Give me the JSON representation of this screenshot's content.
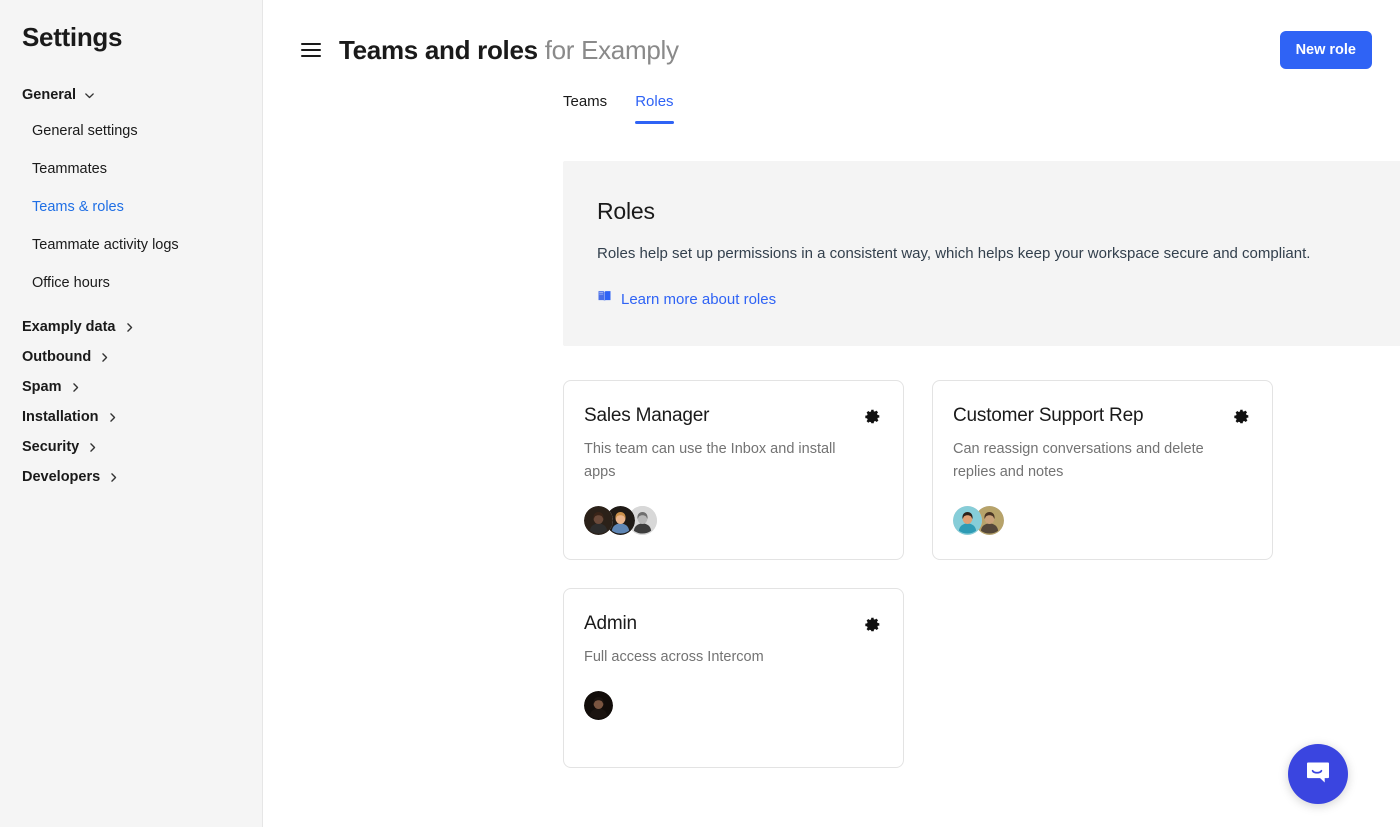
{
  "sidebar": {
    "title": "Settings",
    "groups": [
      {
        "label": "General",
        "icon": "chevron-down-icon",
        "expanded": true,
        "items": [
          {
            "label": "General settings",
            "active": false
          },
          {
            "label": "Teammates",
            "active": false
          },
          {
            "label": "Teams & roles",
            "active": true
          },
          {
            "label": "Teammate activity logs",
            "active": false
          },
          {
            "label": "Office hours",
            "active": false
          }
        ]
      },
      {
        "label": "Examply data",
        "icon": "chevron-right-icon",
        "expanded": false,
        "items": []
      },
      {
        "label": "Outbound",
        "icon": "chevron-right-icon",
        "expanded": false,
        "items": []
      },
      {
        "label": "Spam",
        "icon": "chevron-right-icon",
        "expanded": false,
        "items": []
      },
      {
        "label": "Installation",
        "icon": "chevron-right-icon",
        "expanded": false,
        "items": []
      },
      {
        "label": "Security",
        "icon": "chevron-right-icon",
        "expanded": false,
        "items": []
      },
      {
        "label": "Developers",
        "icon": "chevron-right-icon",
        "expanded": false,
        "items": []
      }
    ]
  },
  "header": {
    "menu_icon": "hamburger-icon",
    "title": "Teams and roles",
    "title_suffix": "for Examply",
    "new_role_label": "New role"
  },
  "tabs": [
    {
      "label": "Teams",
      "active": false
    },
    {
      "label": "Roles",
      "active": true
    }
  ],
  "banner": {
    "heading": "Roles",
    "description": "Roles help set up permissions in a consistent way, which helps keep your workspace secure and compliant.",
    "link_icon": "book-icon",
    "link_label": "Learn more about roles"
  },
  "roles": [
    {
      "name": "Sales Manager",
      "description": "This team can use the Inbox and install apps",
      "settings_icon": "gear-icon",
      "members": [
        {
          "skin": "#6b4a3a",
          "hair": "#3a2418",
          "shirt": "#2d2d2d",
          "bg": "#2b2119"
        },
        {
          "skin": "#e8b48c",
          "hair": "#c98f4a",
          "shirt": "#5e86b5",
          "bg": "#1f1a16"
        },
        {
          "skin": "#b8b8b8",
          "hair": "#6f6f6f",
          "shirt": "#3d3d3d",
          "bg": "#d8d8d8"
        }
      ]
    },
    {
      "name": "Customer Support Rep",
      "description": "Can reassign conversations and delete replies and notes",
      "settings_icon": "gear-icon",
      "members": [
        {
          "skin": "#e0a074",
          "hair": "#2e2119",
          "shirt": "#2e9bb5",
          "bg": "#86cdd8"
        },
        {
          "skin": "#caa27a",
          "hair": "#4a3524",
          "shirt": "#55483a",
          "bg": "#b7a36a"
        }
      ]
    },
    {
      "name": "Admin",
      "description": "Full access across Intercom",
      "settings_icon": "gear-icon",
      "members": [
        {
          "skin": "#7a5540",
          "hair": "#1b1410",
          "shirt": "#1b1410",
          "bg": "#120d0a"
        }
      ]
    }
  ],
  "messenger": {
    "icon": "chat-bubble-icon",
    "color": "#3a45e0"
  },
  "colors": {
    "accent": "#2f63f5",
    "sidebar_bg": "#f5f5f5",
    "banner_bg": "#f4f4f4",
    "text": "#1a1a1a",
    "muted": "#8a8a8a"
  }
}
